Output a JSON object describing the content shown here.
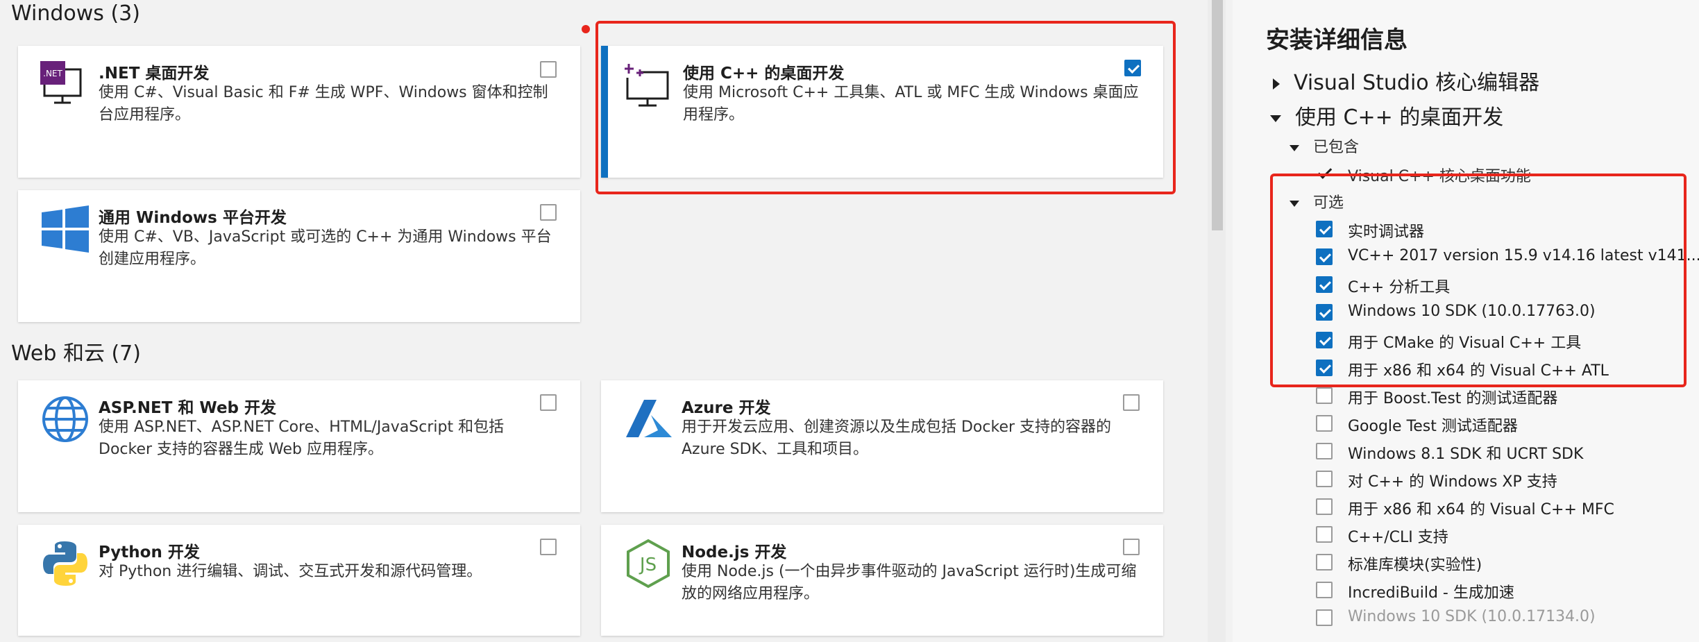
{
  "sections": {
    "windows_title": "Windows (3)",
    "web_title": "Web 和云 (7)"
  },
  "cards": {
    "dotnet": {
      "title": ".NET 桌面开发",
      "desc": "使用 C#、Visual Basic 和 F# 生成 WPF、Windows 窗体和控制台应用程序。",
      "checked": false,
      "badge": ".NET"
    },
    "cpp": {
      "title": "使用 C++ 的桌面开发",
      "desc": "使用 Microsoft C++ 工具集、ATL 或 MFC 生成 Windows 桌面应用程序。",
      "checked": true
    },
    "uwp": {
      "title": "通用 Windows 平台开发",
      "desc": "使用 C#、VB、JavaScript 或可选的 C++ 为通用 Windows 平台创建应用程序。",
      "checked": false
    },
    "aspnet": {
      "title": "ASP.NET 和 Web 开发",
      "desc": "使用 ASP.NET、ASP.NET Core、HTML/JavaScript 和包括 Docker 支持的容器生成 Web 应用程序。",
      "checked": false
    },
    "azure": {
      "title": "Azure 开发",
      "desc": "用于开发云应用、创建资源以及生成包括 Docker 支持的容器的 Azure SDK、工具和项目。",
      "checked": false
    },
    "python": {
      "title": "Python 开发",
      "desc": "对 Python 进行编辑、调试、交互式开发和源代码管理。",
      "checked": false
    },
    "nodejs": {
      "title": "Node.js 开发",
      "desc": "使用 Node.js (一个由异步事件驱动的 JavaScript 运行时)生成可缩放的网络应用程序。",
      "checked": false
    }
  },
  "details": {
    "title": "安装详细信息",
    "core_editor": "Visual Studio 核心编辑器",
    "cpp_desktop": "使用 C++ 的桌面开发",
    "included_label": "已包含",
    "included_item": "Visual C++ 核心桌面功能",
    "optional_label": "可选",
    "optional_items": [
      {
        "label": "实时调试器",
        "checked": true
      },
      {
        "label": "VC++ 2017 version 15.9 v14.16 latest v141...",
        "checked": true
      },
      {
        "label": "C++ 分析工具",
        "checked": true
      },
      {
        "label": "Windows 10 SDK (10.0.17763.0)",
        "checked": true
      },
      {
        "label": "用于 CMake 的 Visual C++ 工具",
        "checked": true
      },
      {
        "label": "用于 x86 和 x64 的 Visual C++ ATL",
        "checked": true
      },
      {
        "label": "用于 Boost.Test 的测试适配器",
        "checked": false
      },
      {
        "label": "Google Test 测试适配器",
        "checked": false
      },
      {
        "label": "Windows 8.1 SDK 和 UCRT SDK",
        "checked": false
      },
      {
        "label": "对 C++ 的 Windows XP 支持",
        "checked": false
      },
      {
        "label": "用于 x86 和 x64 的 Visual C++ MFC",
        "checked": false
      },
      {
        "label": "C++/CLI 支持",
        "checked": false
      },
      {
        "label": "标准库模块(实验性)",
        "checked": false
      },
      {
        "label": "IncrediBuild - 生成加速",
        "checked": false
      },
      {
        "label": "Windows 10 SDK (10.0.17134.0)",
        "checked": false
      }
    ]
  },
  "colors": {
    "accent": "#0e70c0",
    "annotation_red": "#e8261c",
    "dotnet_purple": "#68217a",
    "windows_blue": "#2d7dd2",
    "python_blue": "#3776ab",
    "python_yellow": "#ffd43b",
    "node_green": "#5fa04e"
  }
}
